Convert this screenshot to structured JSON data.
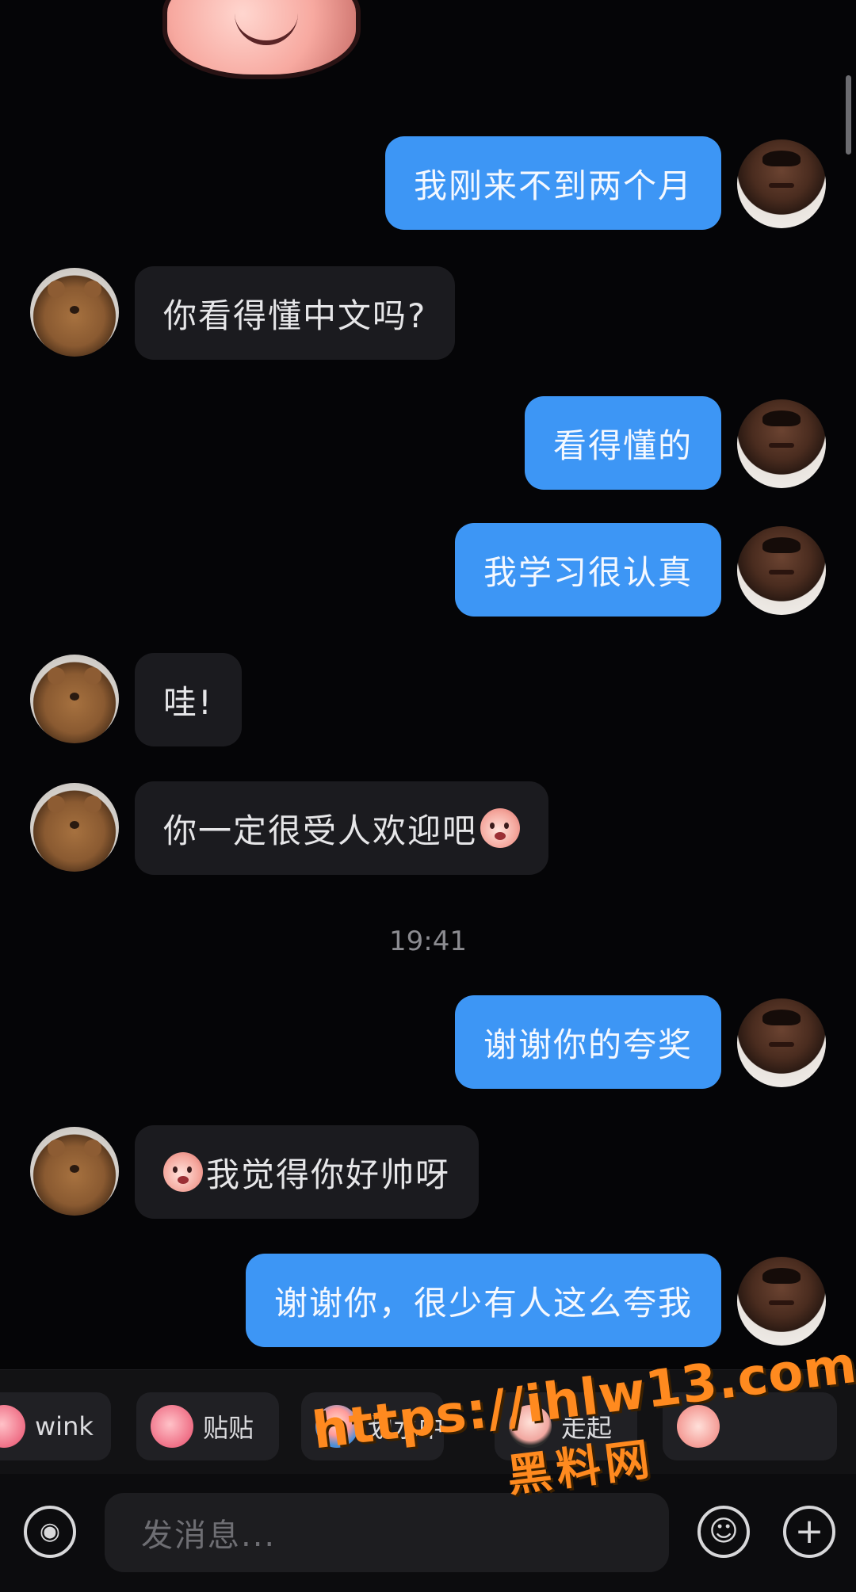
{
  "conversation": {
    "messages": [
      {
        "sender": "self",
        "text": "我刚来不到两个月"
      },
      {
        "sender": "other",
        "text": "你看得懂中文吗?"
      },
      {
        "sender": "self",
        "text": "看得懂的"
      },
      {
        "sender": "self",
        "text": "我学习很认真"
      },
      {
        "sender": "other",
        "text": "哇!"
      },
      {
        "sender": "other",
        "text": "你一定很受人欢迎吧",
        "trailing_emoji": "peach-face-emoji"
      },
      {
        "sender": "self",
        "text": "谢谢你的夸奖"
      },
      {
        "sender": "other",
        "text": "我觉得你好帅呀",
        "leading_emoji": "peach-face-emoji"
      },
      {
        "sender": "self",
        "text": "谢谢你，很少有人这么夸我"
      }
    ],
    "timestamp": "19:41"
  },
  "sticker_bar": {
    "items": [
      {
        "label": "wink",
        "icon": "wink-sticker-icon"
      },
      {
        "label": "贴贴",
        "icon": "cuddle-sticker-icon"
      },
      {
        "label": "划水中",
        "icon": "swimming-sticker-icon"
      },
      {
        "label": "走起",
        "icon": "lets-go-sticker-icon"
      },
      {
        "label": "",
        "icon": "peach-sticker-icon"
      }
    ]
  },
  "input_bar": {
    "placeholder": "发消息...",
    "voice_icon": "voice-icon",
    "emoji_icon": "smiley-icon",
    "plus_icon": "plus-icon"
  },
  "watermark": {
    "url": "https://ihlw13.com",
    "name": "黑料网"
  },
  "colors": {
    "background": "#050507",
    "self_bubble": "#3d96f5",
    "other_bubble": "#1b1b1f",
    "timestamp": "#8b8b90",
    "watermark": "#ff8a1f"
  }
}
